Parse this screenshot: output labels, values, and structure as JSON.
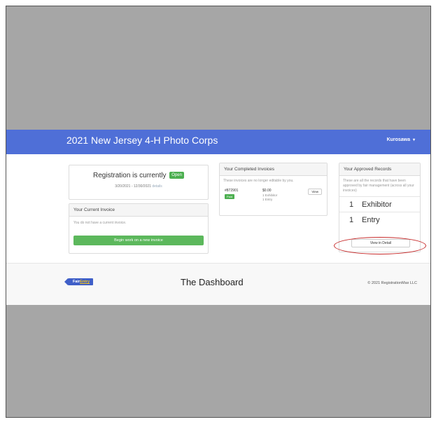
{
  "navbar": {
    "title": "2021 New Jersey 4-H Photo Corps",
    "user": "Kurosawa",
    "caret": "▾"
  },
  "registration": {
    "status_text": "Registration is currently",
    "status_badge": "Open",
    "dates": "3/20/2021 - 12/30/2021",
    "details_link": "details"
  },
  "current_invoice": {
    "header": "Your Current Invoice",
    "message": "You do not have a current invoice.",
    "button": "Begin work on a new invoice"
  },
  "completed_invoices": {
    "header": "Your Completed Invoices",
    "note": "These invoices are no longer editable by you.",
    "items": [
      {
        "number": "#872901",
        "status": "Paid",
        "amount": "$0.00",
        "line1": "1 Exhibitor",
        "line2": "1 Entry",
        "view": "View"
      }
    ]
  },
  "approved_records": {
    "header": "Your Approved Records",
    "description": "These are all the records that have been approved by fair management (across all your invoices)",
    "rows": [
      {
        "count": "1",
        "label": "Exhibitor"
      },
      {
        "count": "1",
        "label": "Entry"
      }
    ],
    "button": "View in Detail"
  },
  "footer": {
    "logo_fair": "Fair",
    "logo_entry": "Entry",
    "title": "The Dashboard",
    "copyright": "© 2021 RegistrationMax LLC"
  },
  "colors": {
    "navbar": "#4f6fd7",
    "success": "#5cb85c",
    "highlight": "#c62828",
    "backdrop": "#a6a6a6"
  }
}
